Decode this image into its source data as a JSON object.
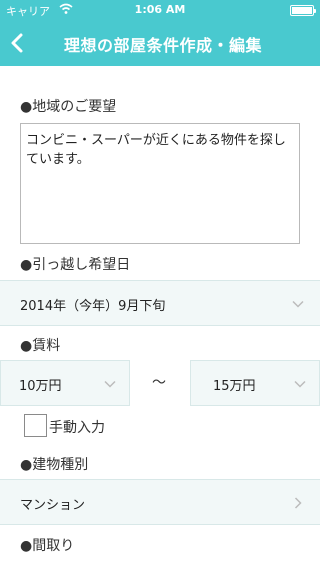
{
  "status_bar": {
    "carrier": "キャリア",
    "time": "1:06 AM"
  },
  "header": {
    "title": "理想の部屋条件作成・編集"
  },
  "area_request": {
    "label": "●地域のご要望",
    "value": "コンビニ・スーパーが近くにある物件を探しています。"
  },
  "move_date": {
    "label": "●引っ越し希望日",
    "value": "2014年（今年）9月下旬"
  },
  "rent": {
    "label": "●賃料",
    "min": "10万円",
    "separator": "〜",
    "max": "15万円",
    "manual_input_label": "手動入力",
    "manual_input_checked": false
  },
  "building_type": {
    "label": "●建物種別",
    "value": "マンション"
  },
  "floor_plan": {
    "label": "●間取り"
  },
  "colors": {
    "accent": "#49c9cf",
    "row_bg": "#f2f8f8",
    "chevron": "#bcbcbc"
  }
}
